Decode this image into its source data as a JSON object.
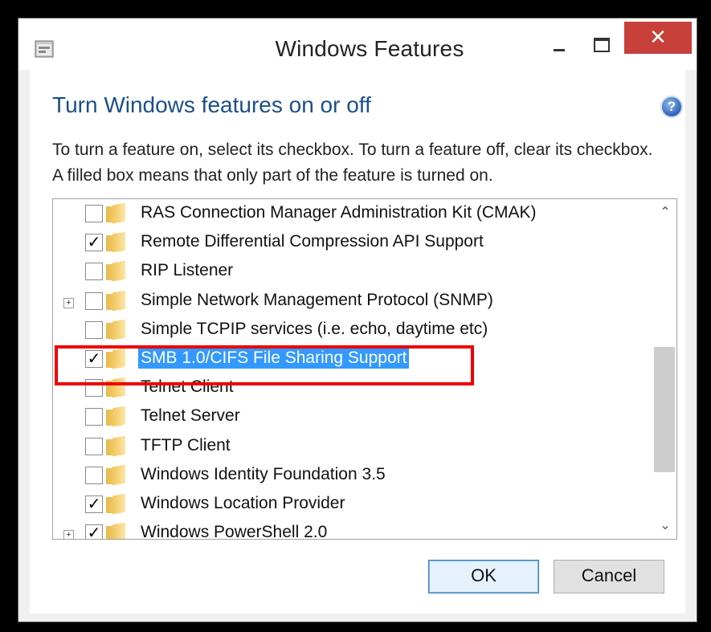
{
  "window": {
    "title": "Windows Features"
  },
  "heading": "Turn Windows features on or off",
  "description": "To turn a feature on, select its checkbox. To turn a feature off, clear its checkbox. A filled box means that only part of the feature is turned on.",
  "features": [
    {
      "label": "RAS Connection Manager Administration Kit (CMAK)",
      "checked": false,
      "expandable": false
    },
    {
      "label": "Remote Differential Compression API Support",
      "checked": true,
      "expandable": false
    },
    {
      "label": "RIP Listener",
      "checked": false,
      "expandable": false
    },
    {
      "label": "Simple Network Management Protocol (SNMP)",
      "checked": false,
      "expandable": true
    },
    {
      "label": "Simple TCPIP services (i.e. echo, daytime etc)",
      "checked": false,
      "expandable": false
    },
    {
      "label": "SMB 1.0/CIFS File Sharing Support",
      "checked": true,
      "expandable": false,
      "selected": true
    },
    {
      "label": "Telnet Client",
      "checked": false,
      "expandable": false
    },
    {
      "label": "Telnet Server",
      "checked": false,
      "expandable": false
    },
    {
      "label": "TFTP Client",
      "checked": false,
      "expandable": false
    },
    {
      "label": "Windows Identity Foundation 3.5",
      "checked": false,
      "expandable": false
    },
    {
      "label": "Windows Location Provider",
      "checked": true,
      "expandable": false
    },
    {
      "label": "Windows PowerShell 2.0",
      "checked": true,
      "expandable": true
    }
  ],
  "buttons": {
    "ok": "OK",
    "cancel": "Cancel"
  },
  "icons": {
    "expand": "plus-icon",
    "folder": "folder-icon",
    "help": "help-icon",
    "close": "close-icon"
  },
  "colors": {
    "heading": "#1b4f8a",
    "selection": "#3399ff",
    "close_button": "#c7403a",
    "annotation": "#e00000"
  }
}
